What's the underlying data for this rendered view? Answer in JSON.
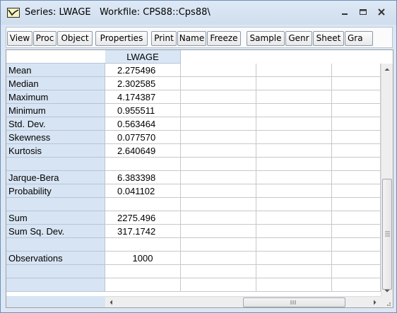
{
  "window": {
    "title": "Series: LWAGE   Workfile: CPS88::Cps88\\",
    "minimize_glyph": "–",
    "maximize_glyph": "□",
    "close_glyph": "x"
  },
  "toolbar": {
    "buttons": [
      "View",
      "Proc",
      "Object",
      "Properties",
      "Print",
      "Name",
      "Freeze",
      "Sample",
      "Genr",
      "Sheet",
      "Gra"
    ]
  },
  "table": {
    "column_header": "LWAGE",
    "rows": [
      {
        "label": "Mean",
        "value": "2.275496"
      },
      {
        "label": "Median",
        "value": "2.302585"
      },
      {
        "label": "Maximum",
        "value": "4.174387"
      },
      {
        "label": "Minimum",
        "value": "0.955511"
      },
      {
        "label": "Std. Dev.",
        "value": "0.563464"
      },
      {
        "label": "Skewness",
        "value": "0.077570"
      },
      {
        "label": "Kurtosis",
        "value": "2.640649"
      },
      {
        "label": "",
        "value": ""
      },
      {
        "label": "Jarque-Bera",
        "value": "6.383398"
      },
      {
        "label": "Probability",
        "value": "0.041102"
      },
      {
        "label": "",
        "value": ""
      },
      {
        "label": "Sum",
        "value": "2275.496"
      },
      {
        "label": "Sum Sq. Dev.",
        "value": "317.1742"
      },
      {
        "label": "",
        "value": ""
      },
      {
        "label": "Observations",
        "value": "1000"
      },
      {
        "label": "",
        "value": ""
      },
      {
        "label": "",
        "value": ""
      }
    ]
  },
  "scrollbars": {
    "horizontal_grip_glyph": "III",
    "vertical_grip_glyph": "≡"
  },
  "colors": {
    "row_label_bg": "#d7e4f3",
    "window_border": "#6d8fb8"
  }
}
